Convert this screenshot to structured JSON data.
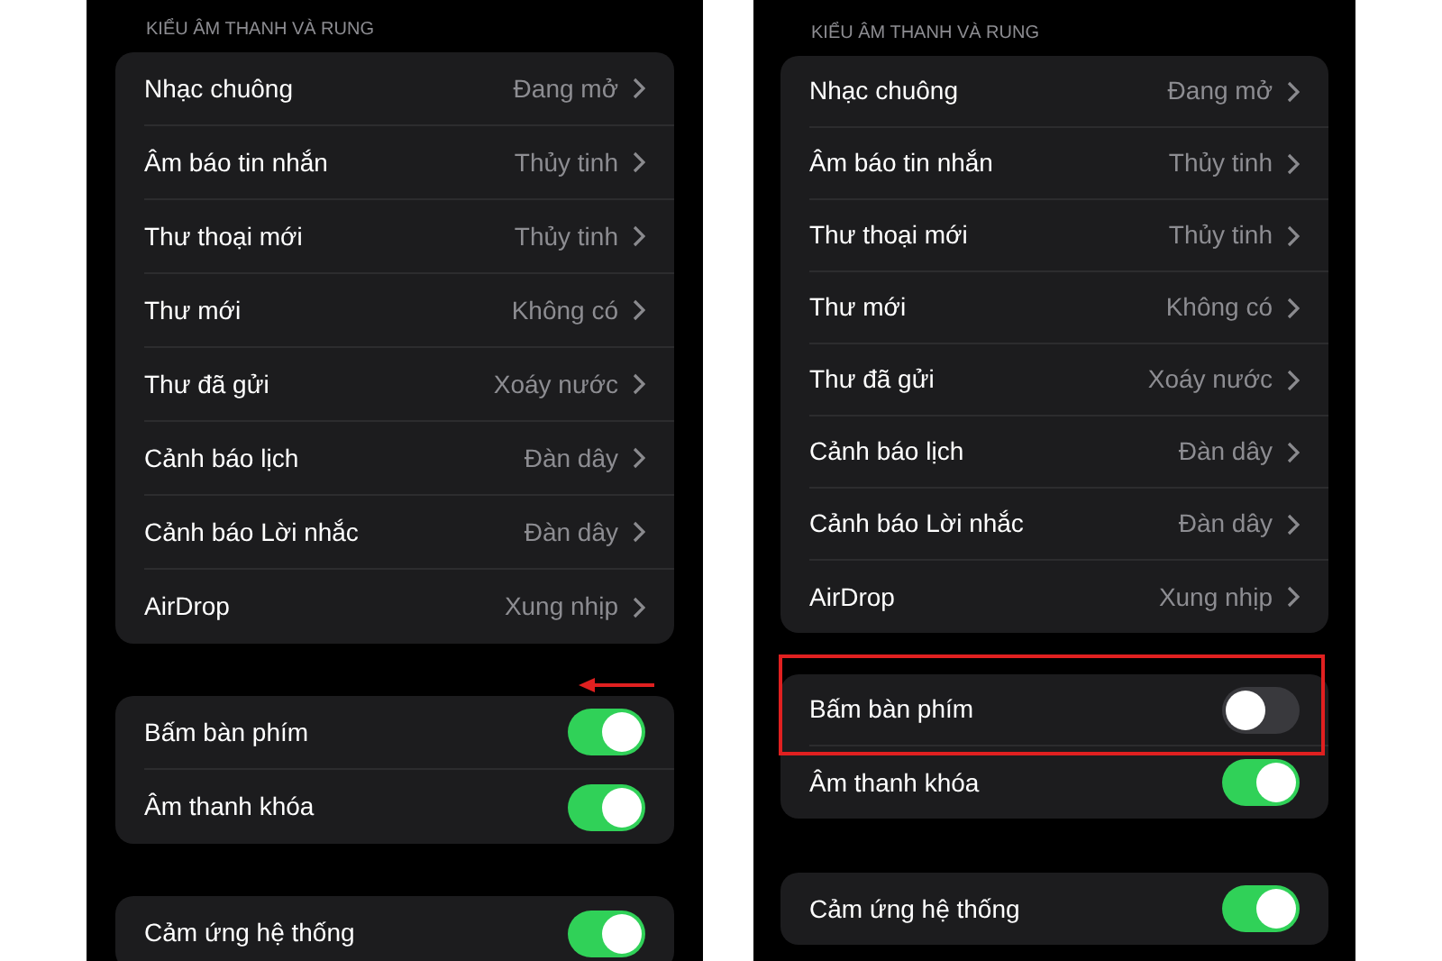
{
  "panels": [
    {
      "section_header": "KIỂU ÂM THANH VÀ RUNG",
      "sound_rows": [
        {
          "label": "Nhạc chuông",
          "value": "Đang mở"
        },
        {
          "label": "Âm báo tin nhắn",
          "value": "Thủy tinh"
        },
        {
          "label": "Thư thoại mới",
          "value": "Thủy tinh"
        },
        {
          "label": "Thư mới",
          "value": "Không có"
        },
        {
          "label": "Thư đã gửi",
          "value": "Xoáy nước"
        },
        {
          "label": "Cảnh báo lịch",
          "value": "Đàn dây"
        },
        {
          "label": "Cảnh báo Lời nhắc",
          "value": "Đàn dây"
        },
        {
          "label": "AirDrop",
          "value": "Xung nhịp"
        }
      ],
      "toggle_rows": [
        {
          "label": "Bấm bàn phím",
          "on": true
        },
        {
          "label": "Âm thanh khóa",
          "on": true
        }
      ],
      "bottom_rows": [
        {
          "label": "Cảm ứng hệ thống",
          "on": true
        }
      ],
      "annotation": {
        "kind": "arrow"
      }
    },
    {
      "section_header": "KIỂU ÂM THANH VÀ RUNG",
      "sound_rows": [
        {
          "label": "Nhạc chuông",
          "value": "Đang mở"
        },
        {
          "label": "Âm báo tin nhắn",
          "value": "Thủy tinh"
        },
        {
          "label": "Thư thoại mới",
          "value": "Thủy tinh"
        },
        {
          "label": "Thư mới",
          "value": "Không có"
        },
        {
          "label": "Thư đã gửi",
          "value": "Xoáy nước"
        },
        {
          "label": "Cảnh báo lịch",
          "value": "Đàn dây"
        },
        {
          "label": "Cảnh báo Lời nhắc",
          "value": "Đàn dây"
        },
        {
          "label": "AirDrop",
          "value": "Xung nhịp"
        }
      ],
      "toggle_rows": [
        {
          "label": "Bấm bàn phím",
          "on": false
        },
        {
          "label": "Âm thanh khóa",
          "on": true
        }
      ],
      "bottom_rows": [
        {
          "label": "Cảm ứng hệ thống",
          "on": true
        }
      ],
      "annotation": {
        "kind": "box"
      }
    }
  ]
}
